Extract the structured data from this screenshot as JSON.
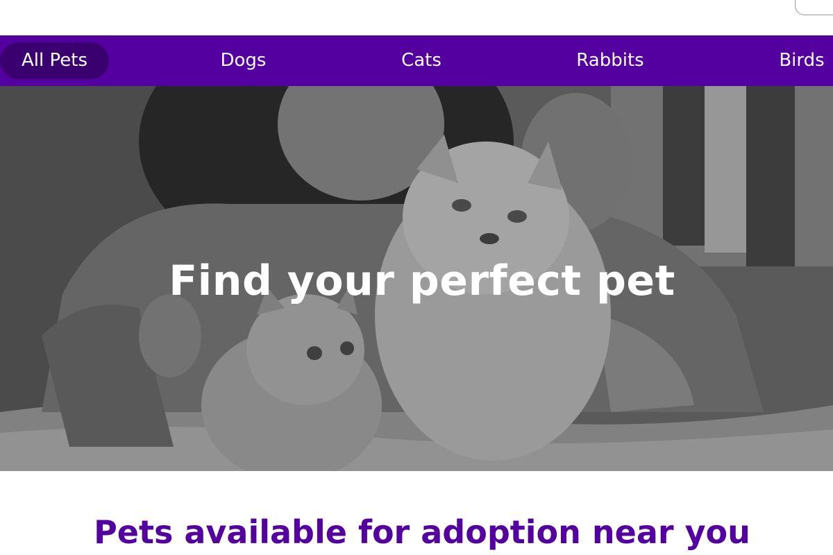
{
  "nav": {
    "items": [
      {
        "label": "All Pets",
        "active": true
      },
      {
        "label": "Dogs"
      },
      {
        "label": "Cats"
      },
      {
        "label": "Rabbits"
      },
      {
        "label": "Birds"
      }
    ]
  },
  "hero": {
    "title": "Find your perfect pet"
  },
  "section": {
    "title": "Pets available for adoption near you"
  },
  "colors": {
    "brand": "#5400a0",
    "nav_active": "#3a0070",
    "text_on_brand": "#ffffff"
  }
}
